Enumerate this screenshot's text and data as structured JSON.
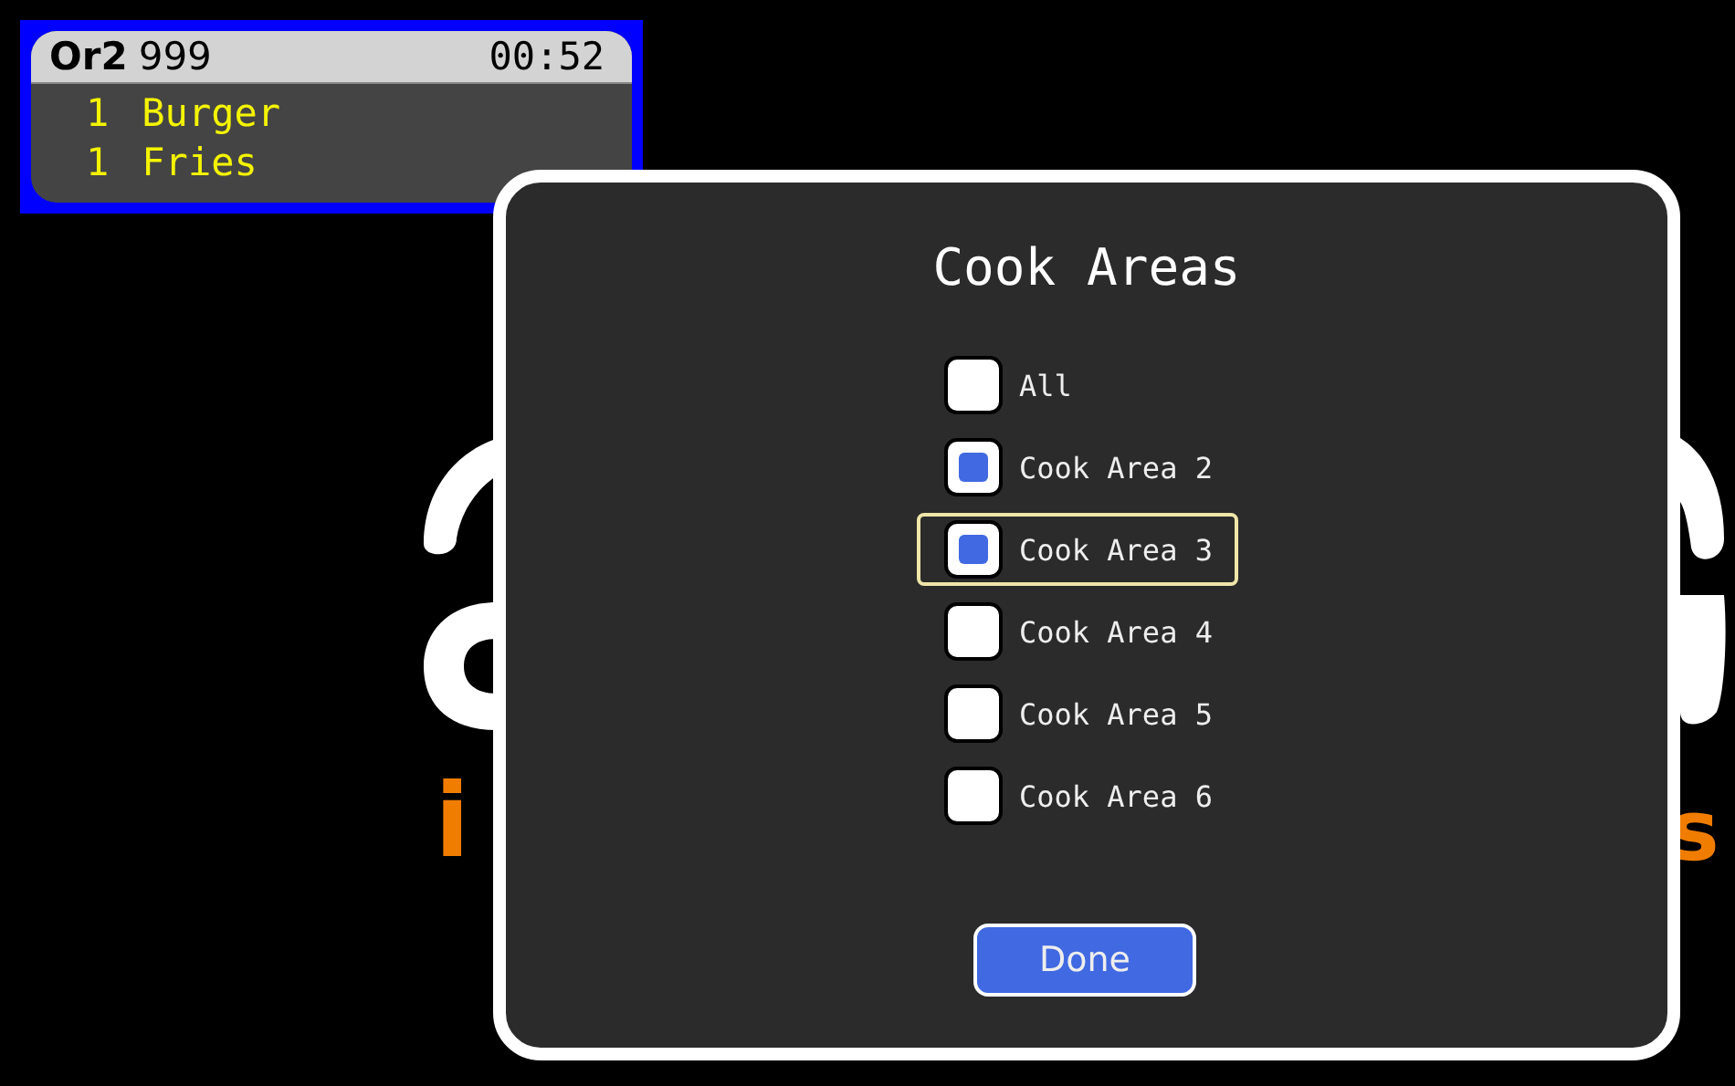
{
  "order_ticket": {
    "order_label": "Or2",
    "order_number": "999",
    "timer": "00:52",
    "items": [
      {
        "qty": "1",
        "name": "Burger"
      },
      {
        "qty": "1",
        "name": "Fries"
      }
    ]
  },
  "background_logo": {
    "texts": [
      "i",
      "s"
    ]
  },
  "dialog": {
    "title": "Cook Areas",
    "options": [
      {
        "label": "All",
        "checked": false,
        "selected": false
      },
      {
        "label": "Cook Area 2",
        "checked": true,
        "selected": false
      },
      {
        "label": "Cook Area 3",
        "checked": true,
        "selected": true
      },
      {
        "label": "Cook Area 4",
        "checked": false,
        "selected": false
      },
      {
        "label": "Cook Area 5",
        "checked": false,
        "selected": false
      },
      {
        "label": "Cook Area 6",
        "checked": false,
        "selected": false
      }
    ],
    "done_button": "Done"
  }
}
